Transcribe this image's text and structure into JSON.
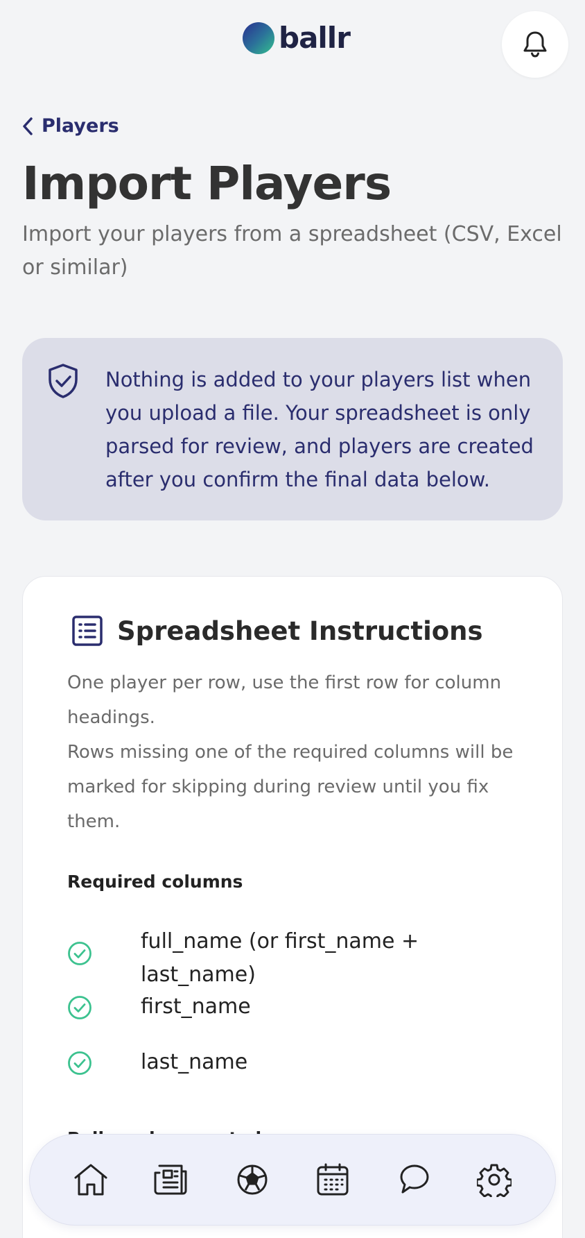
{
  "header": {
    "logo_text": "ballr",
    "notifications_icon": "bell-icon"
  },
  "back": {
    "label": "Players",
    "icon": "chevron-left-icon"
  },
  "page": {
    "title": "Import Players",
    "subtitle": "Import your players from a spreadsheet (CSV, Excel or similar)"
  },
  "notice": {
    "icon": "shield-check-icon",
    "text": "Nothing is added to your players list when you upload a file. Your spreadsheet is only parsed for review, and players are created after you confirm the final data below."
  },
  "instructions": {
    "icon": "list-icon",
    "title": "Spreadsheet Instructions",
    "line1": "One player per row, use the first row for column headings.",
    "line2": "Rows missing one of the required columns will be marked for skipping during review until you fix them.",
    "required_label": "Required columns",
    "required": [
      {
        "label": "full_name (or first_name + last_name)"
      },
      {
        "label": "first_name"
      },
      {
        "label": "last_name"
      }
    ],
    "next_section_partial": "Ballr and supported"
  },
  "nav": [
    {
      "icon": "home-icon"
    },
    {
      "icon": "news-icon"
    },
    {
      "icon": "football-icon"
    },
    {
      "icon": "calendar-icon"
    },
    {
      "icon": "chat-icon"
    },
    {
      "icon": "settings-icon"
    }
  ],
  "colors": {
    "brand_navy": "#2a2d6e",
    "accent_green": "#3cc28f",
    "notice_bg": "#dcdde8",
    "page_bg": "#f3f4f6"
  }
}
